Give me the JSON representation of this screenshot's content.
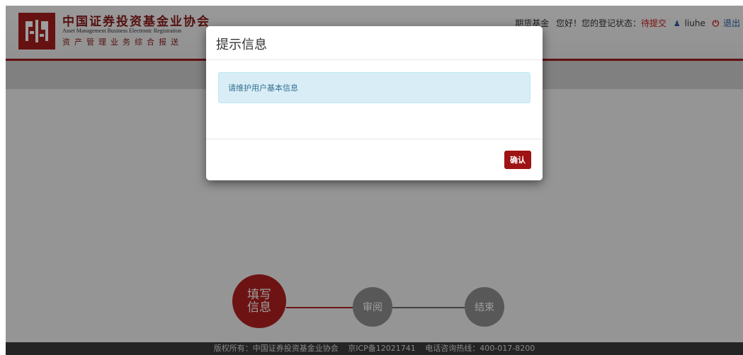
{
  "header": {
    "org_name_cn": "中国证券投资基金业协会",
    "org_name_en": "Asset Management Business Electronic Registration",
    "org_sub_cn": "资产管理业务综合报送",
    "user_org": "期货基金",
    "greeting": "您好！您的登记状态：",
    "status_value": "待提交",
    "username": "liuhe",
    "logout_label": "退出"
  },
  "modal": {
    "title": "提示信息",
    "message": "请维护用户基本信息",
    "confirm_label": "确认"
  },
  "steps": [
    {
      "label": "填写\n信息",
      "active": true
    },
    {
      "label": "审阅",
      "active": false
    },
    {
      "label": "结束",
      "active": false
    }
  ],
  "footer": {
    "copyright": "版权所有：中国证券投资基金业协会",
    "icp": "京ICP备12021741",
    "hotline": "电话咨询热线：400-017-8200"
  },
  "colors": {
    "brand_red": "#a61d1d",
    "alert_bg": "#d9edf7",
    "alert_text": "#31708f",
    "step_inactive": "#8f8f8f"
  },
  "icons": [
    "logo-icon",
    "user-icon",
    "power-icon"
  ]
}
